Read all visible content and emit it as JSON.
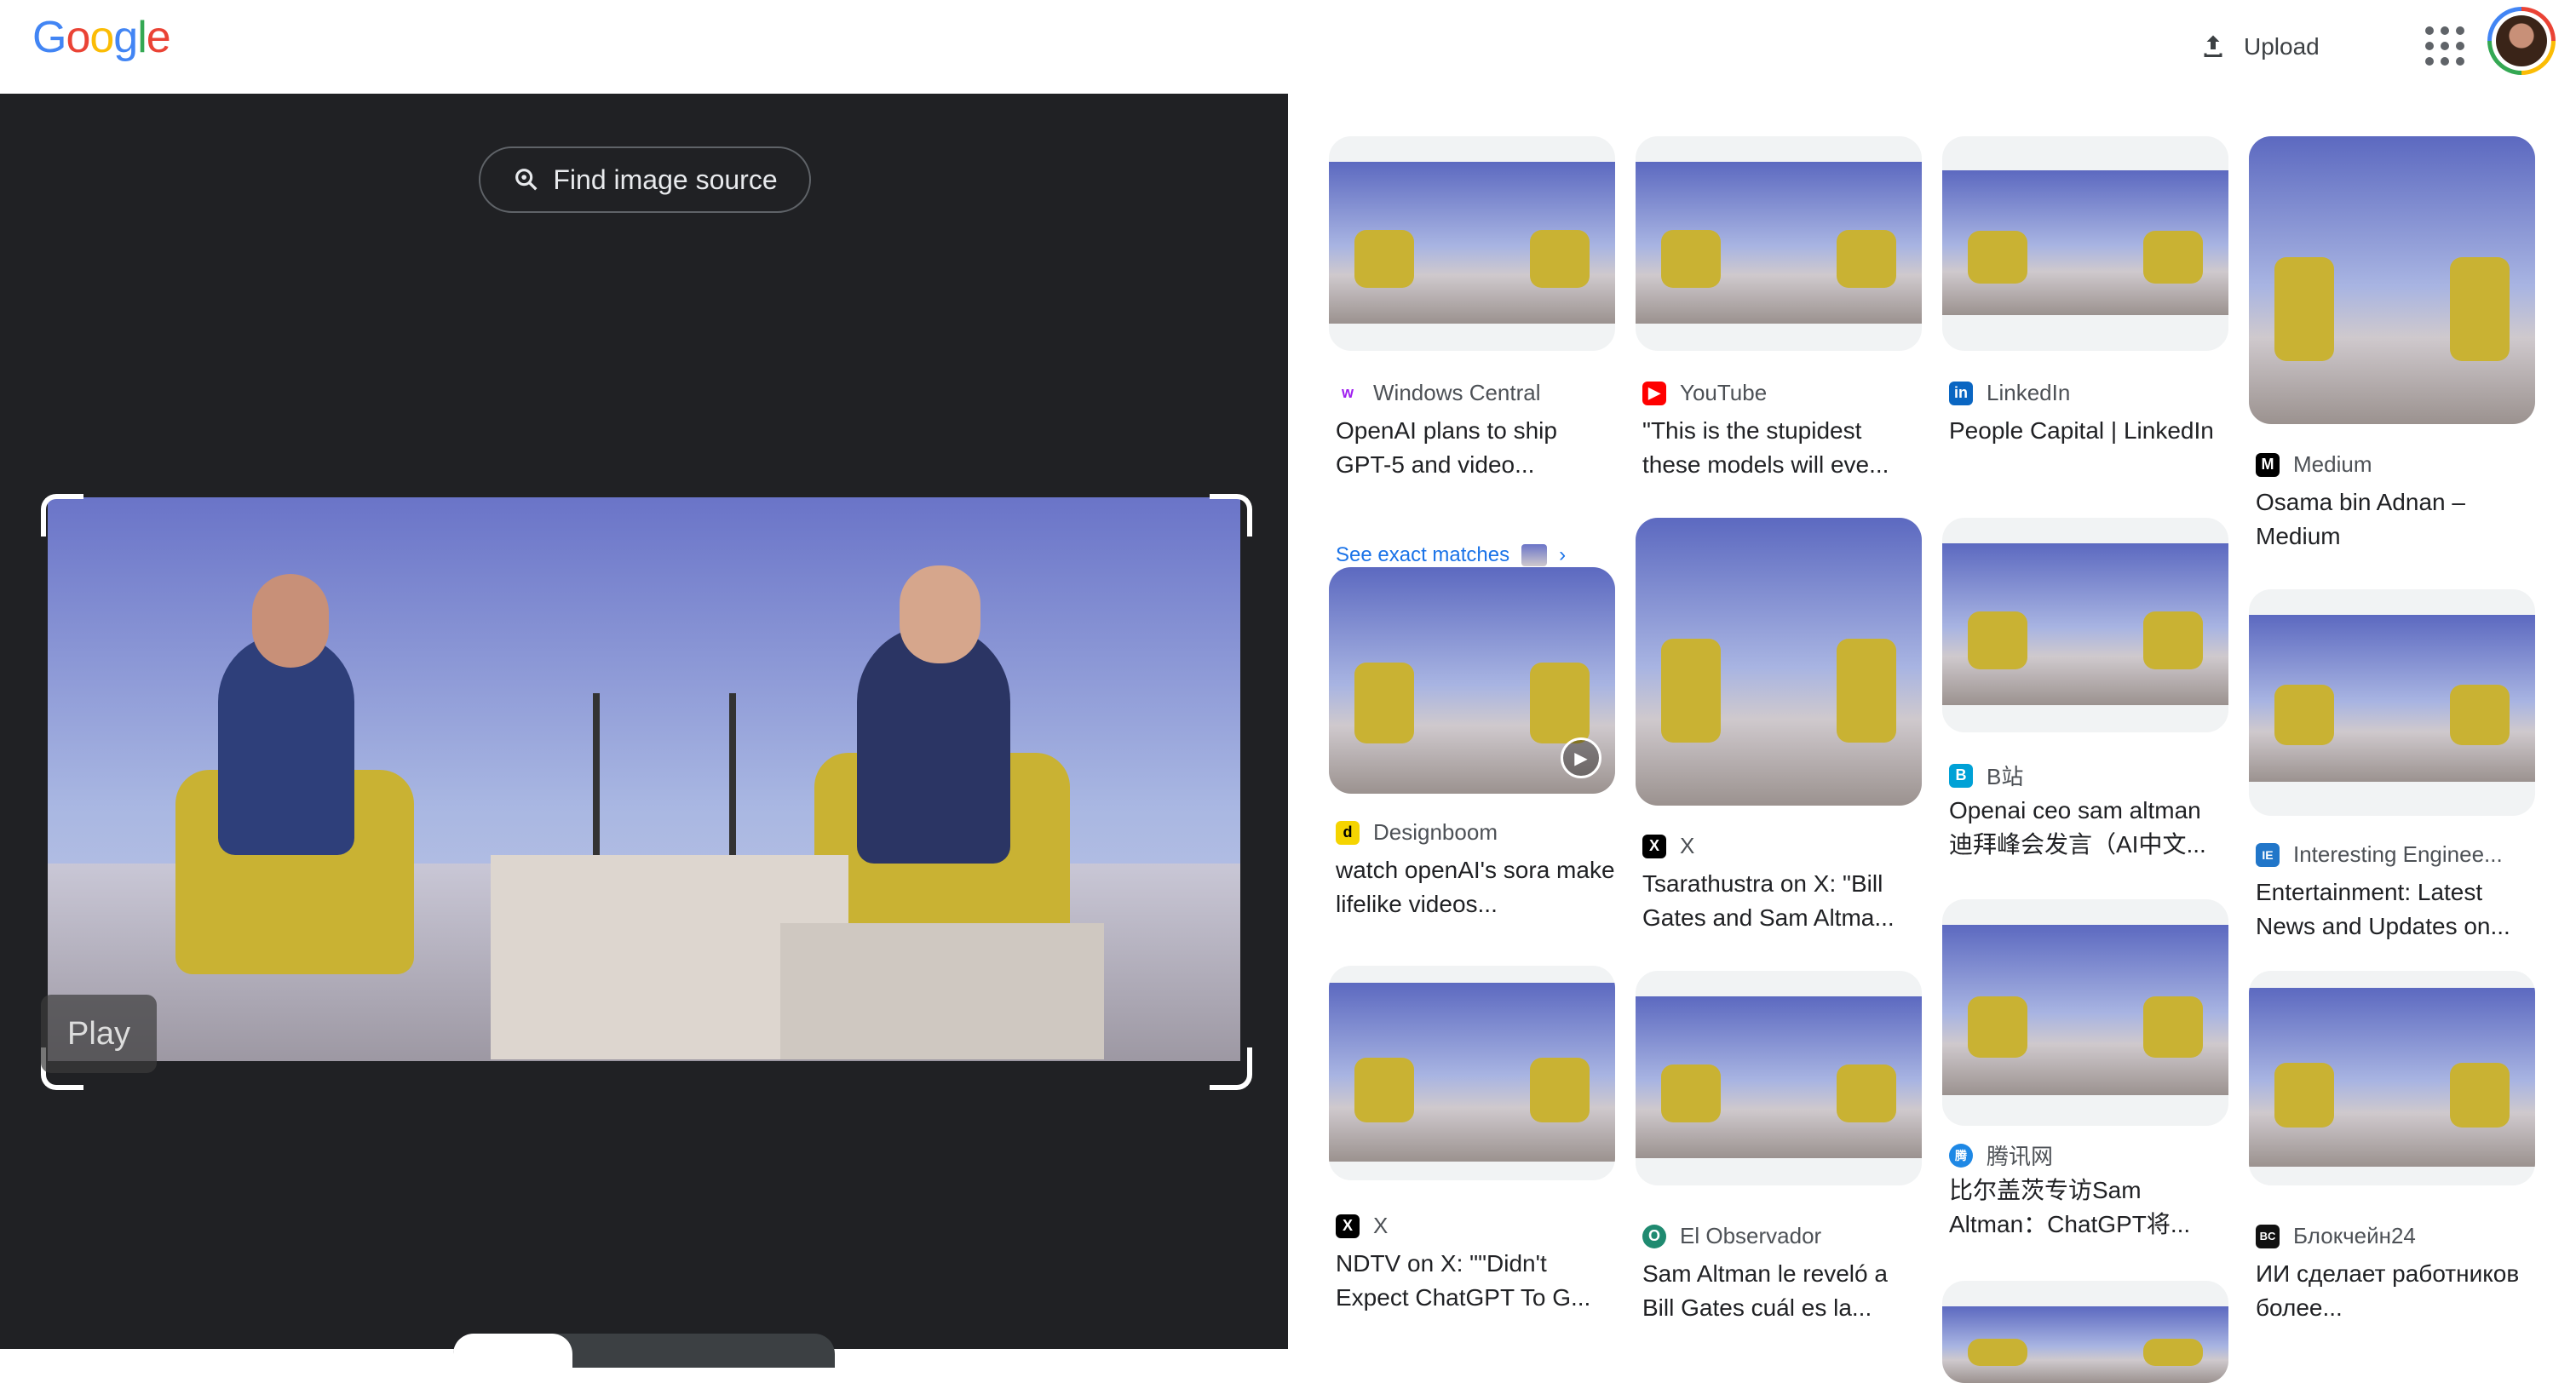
{
  "header": {
    "logo": [
      "G",
      "o",
      "o",
      "g",
      "l",
      "e"
    ],
    "logo_colors": [
      "#4285f4",
      "#ea4335",
      "#fbbc05",
      "#4285f4",
      "#34a853",
      "#ea4335"
    ],
    "upload_label": "Upload",
    "apps_icon": "apps-grid-icon",
    "avatar_icon": "account-avatar"
  },
  "left": {
    "find_source_label": "Find image source",
    "play_label": "Play"
  },
  "results": {
    "col1": [
      {
        "source": "Windows Central",
        "icon_text": "w",
        "icon_color": "#ffffff",
        "title": "OpenAI plans to ship GPT-5 and video...",
        "exact_label": "See exact matches"
      },
      {
        "source": "Designboom",
        "icon_text": "d",
        "icon_color": "#f5d400",
        "title": "watch openAI's sora make lifelike videos..."
      },
      {
        "source": "X",
        "icon_text": "X",
        "icon_color": "#000000",
        "title": "NDTV on X: \"\"Didn't Expect ChatGPT To G..."
      }
    ],
    "col2": [
      {
        "source": "YouTube",
        "icon_text": "▶",
        "icon_color": "#ff0000",
        "title": "\"This is the stupidest these models will eve..."
      },
      {
        "source": "X",
        "icon_text": "X",
        "icon_color": "#000000",
        "title": "Tsarathustra on X: \"Bill Gates and Sam Altma..."
      },
      {
        "source": "El Observador",
        "icon_text": "O",
        "icon_color": "#1f8a70",
        "title": "Sam Altman le reveló a Bill Gates cuál es la..."
      }
    ],
    "col3": [
      {
        "source": "LinkedIn",
        "icon_text": "in",
        "icon_color": "#0a66c2",
        "title": "People Capital | LinkedIn"
      },
      {
        "source": "B站",
        "icon_text": "B",
        "icon_color": "#00a1d6",
        "title": "Openai ceo sam altman 迪拜峰会发言（AI中文..."
      },
      {
        "source": "腾讯网",
        "icon_text": "腾",
        "icon_color": "#1e88e5",
        "title": "比尔盖茨专访Sam Altman：ChatGPT将..."
      }
    ],
    "col4": [
      {
        "source": "Medium",
        "icon_text": "M",
        "icon_color": "#000000",
        "title": "Osama bin Adnan – Medium"
      },
      {
        "source": "Interesting Enginee...",
        "icon_text": "IE",
        "icon_color": "#2176c9",
        "title": "Entertainment: Latest News and Updates on..."
      },
      {
        "source": "Блокчейн24",
        "icon_text": "BC",
        "icon_color": "#111111",
        "title": "ИИ сделает работников более..."
      }
    ]
  }
}
